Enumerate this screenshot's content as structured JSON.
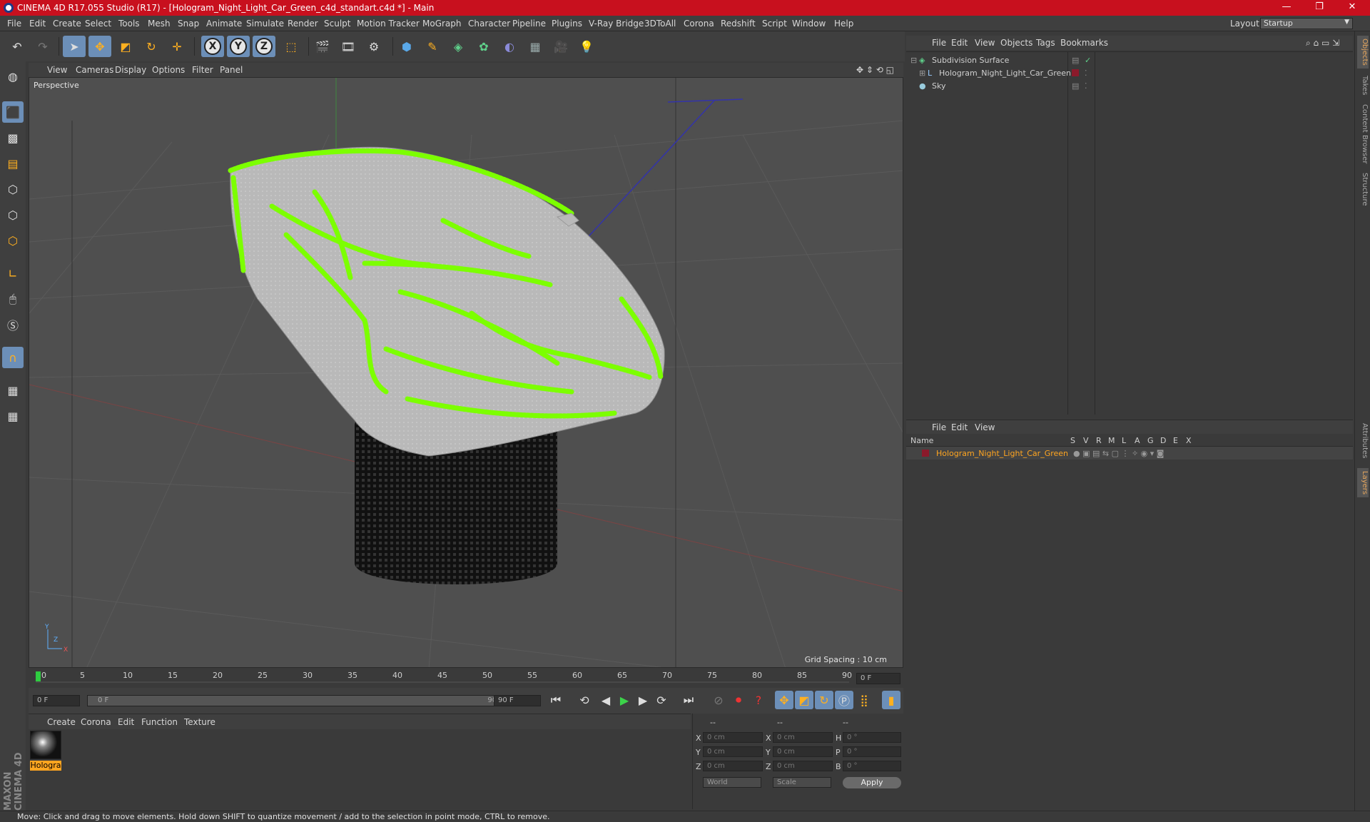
{
  "window": {
    "title": "CINEMA 4D R17.055 Studio (R17) - [Hologram_Night_Light_Car_Green_c4d_standart.c4d *] - Main",
    "minimize": "—",
    "restore": "❐",
    "close": "✕"
  },
  "menubar": {
    "items": [
      "File",
      "Edit",
      "Create",
      "Select",
      "Tools",
      "Mesh",
      "Snap",
      "Animate",
      "Simulate",
      "Render",
      "Sculpt",
      "Motion Tracker",
      "MoGraph",
      "Character",
      "Pipeline",
      "Plugins",
      "V-Ray Bridge",
      "3DToAll",
      "Corona",
      "Redshift",
      "Script",
      "Window",
      "Help"
    ],
    "layout_label": "Layout:",
    "layout_value": "Startup"
  },
  "toolbar": {
    "axis_x": "X",
    "axis_y": "Y",
    "axis_z": "Z"
  },
  "viewport": {
    "menu": [
      "View",
      "Cameras",
      "Display",
      "Options",
      "Filter",
      "Panel"
    ],
    "camera_label": "Perspective",
    "grid_spacing": "Grid Spacing : 10 cm"
  },
  "timeline": {
    "ticks": [
      "0",
      "5",
      "10",
      "15",
      "20",
      "25",
      "30",
      "35",
      "40",
      "45",
      "50",
      "55",
      "60",
      "65",
      "70",
      "75",
      "80",
      "85",
      "90"
    ],
    "current_frame": "0 F",
    "start_field": "0 F",
    "range_start": "0 F",
    "range_end": "90 F",
    "end_field": "90 F"
  },
  "material_manager": {
    "menu": [
      "Create",
      "Corona",
      "Edit",
      "Function",
      "Texture"
    ],
    "material_name": "Hologra"
  },
  "coordinates": {
    "header": [
      "--",
      "--",
      "--"
    ],
    "rows": [
      {
        "axis": "X",
        "pos": "0 cm",
        "axis2": "X",
        "size": "0 cm",
        "axis3": "H",
        "rot": "0 °"
      },
      {
        "axis": "Y",
        "pos": "0 cm",
        "axis2": "Y",
        "size": "0 cm",
        "axis3": "P",
        "rot": "0 °"
      },
      {
        "axis": "Z",
        "pos": "0 cm",
        "axis2": "Z",
        "size": "0 cm",
        "axis3": "B",
        "rot": "0 °"
      }
    ],
    "mode": "World",
    "scale": "Scale",
    "apply": "Apply"
  },
  "object_manager": {
    "menu": [
      "File",
      "Edit",
      "View",
      "Objects",
      "Tags",
      "Bookmarks"
    ],
    "objects": [
      {
        "name": "Subdivision Surface"
      },
      {
        "name": "Hologram_Night_Light_Car_Green"
      },
      {
        "name": "Sky"
      }
    ]
  },
  "layer_manager": {
    "menu": [
      "File",
      "Edit",
      "View"
    ],
    "columns": [
      "Name",
      "S",
      "V",
      "R",
      "M",
      "L",
      "A",
      "G",
      "D",
      "E",
      "X"
    ],
    "layers": [
      {
        "name": "Hologram_Night_Light_Car_Green",
        "color": "#8b1a2b"
      }
    ]
  },
  "side_tabs": [
    "Objects",
    "Takes",
    "Content Browser",
    "Structure",
    "Attributes",
    "Layers"
  ],
  "status": "Move: Click and drag to move elements. Hold down SHIFT to quantize movement / add to the selection in point mode, CTRL to remove.",
  "colors": {
    "titlebar": "#c8101e",
    "accent_blue": "#6c8fb8",
    "hologram_green": "#7cff00",
    "material_highlight": "#ffa520"
  }
}
